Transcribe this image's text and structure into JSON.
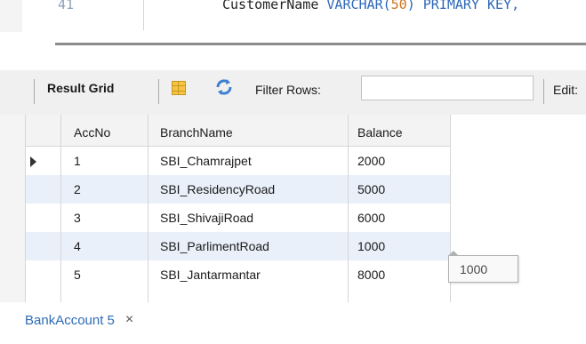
{
  "editor": {
    "line_number": "41",
    "code_plain": "CustomerName ",
    "code_type": "VARCHAR(",
    "code_size": "50",
    "code_rest": ") PRIMARY KEY,"
  },
  "toolbar": {
    "result_grid_label": "Result Grid",
    "filter_label": "Filter Rows:",
    "filter_value": "",
    "edit_label": "Edit:"
  },
  "grid": {
    "columns": [
      "AccNo",
      "BranchName",
      "Balance"
    ],
    "rows": [
      {
        "acc": "1",
        "branch": "SBI_Chamrajpet",
        "balance": "2000"
      },
      {
        "acc": "2",
        "branch": "SBI_ResidencyRoad",
        "balance": "5000"
      },
      {
        "acc": "3",
        "branch": "SBI_ShivajiRoad",
        "balance": "6000"
      },
      {
        "acc": "4",
        "branch": "SBI_ParlimentRoad",
        "balance": "1000"
      },
      {
        "acc": "5",
        "branch": "SBI_Jantarmantar",
        "balance": "8000"
      }
    ],
    "selected_row": 1,
    "tooltip": "1000"
  },
  "tabs": {
    "active_label": "BankAccount 5",
    "close_glyph": "×"
  },
  "colors": {
    "keyword": "#2c67b7",
    "number": "#d0721c",
    "row_alt": "#e9f0fa",
    "tab_text": "#2d6bb5"
  },
  "icons": [
    "grid-layout-icon",
    "refresh-icon",
    "row-pointer-icon",
    "close-icon"
  ]
}
